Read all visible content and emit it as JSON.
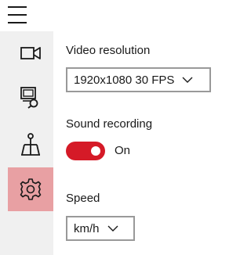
{
  "menu": {
    "icon": "hamburger-icon"
  },
  "nav": {
    "items": [
      {
        "name": "video",
        "icon": "video-camera-icon"
      },
      {
        "name": "monitor",
        "icon": "monitor-search-icon"
      },
      {
        "name": "routes",
        "icon": "route-icon"
      },
      {
        "name": "settings",
        "icon": "gear-icon",
        "active": true
      }
    ],
    "active_color": "#e8a0a3"
  },
  "settings": {
    "video_resolution": {
      "label": "Video resolution",
      "value": "1920x1080 30 FPS"
    },
    "sound_recording": {
      "label": "Sound recording",
      "state_label": "On",
      "on": true,
      "accent": "#d51a27"
    },
    "speed": {
      "label": "Speed",
      "value": "km/h"
    }
  }
}
